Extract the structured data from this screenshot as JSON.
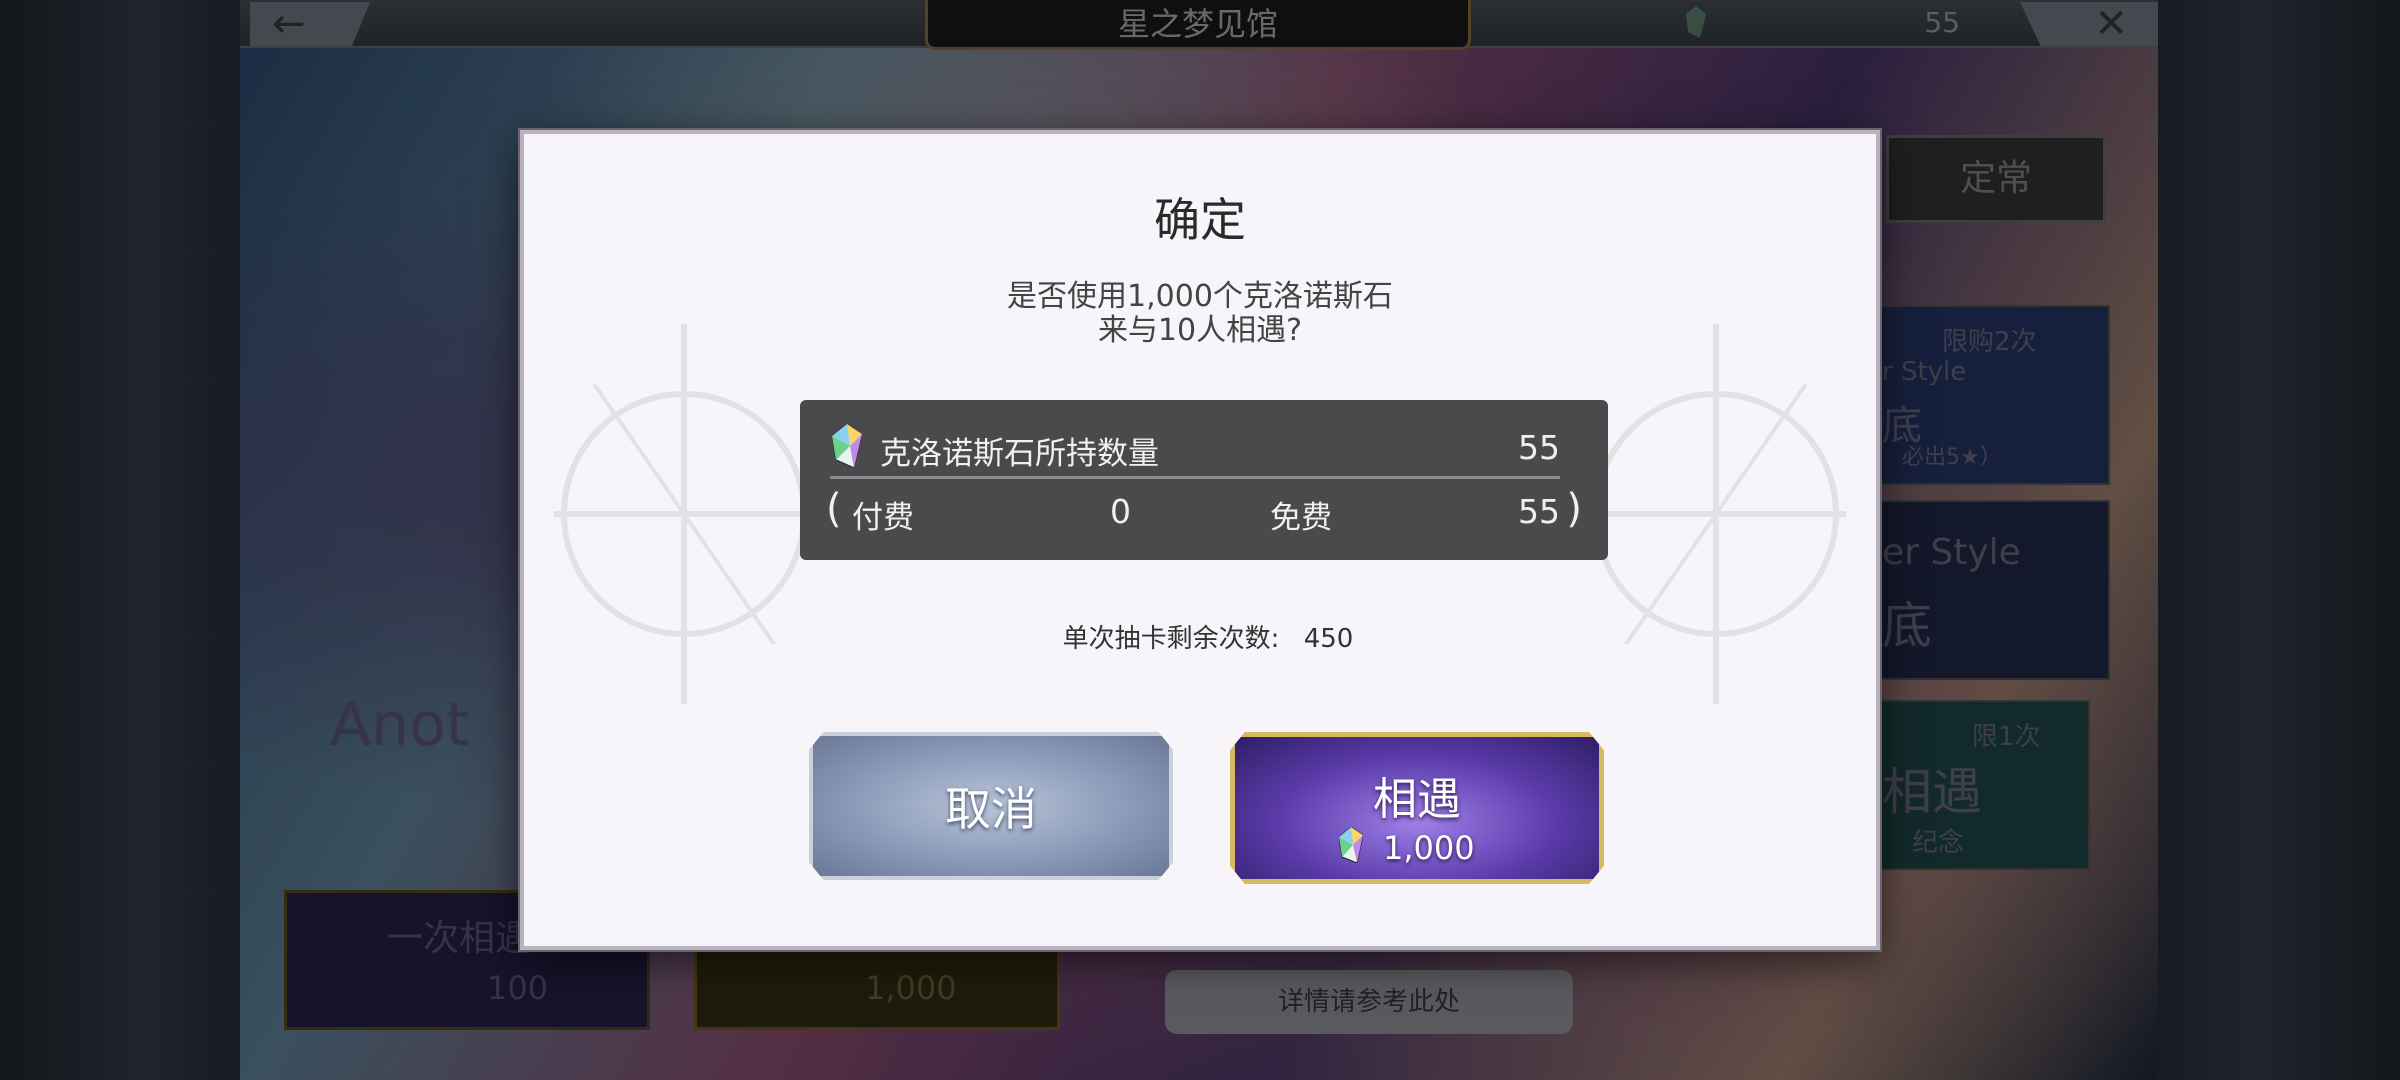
{
  "header": {
    "title": "星之梦见馆",
    "back_icon": "←",
    "close_icon": "✕",
    "currency_count": "55"
  },
  "background": {
    "tab_regular": "定常",
    "card1_badge": "限购2次",
    "card1_text": "r Style",
    "card1_sub": "底",
    "card1_note": "必出5★）",
    "card2_text": "er Style",
    "card2_sub": "底",
    "card3_badge": "限1次",
    "card3_text": "相遇",
    "card3_sub": "纪念",
    "banner_title": "Anot",
    "single_label": "一次相遇",
    "single_cost": "100",
    "ten_cost": "1,000",
    "details_button": "详情请参考此处"
  },
  "dialog": {
    "title": "确定",
    "message_line1": "是否使用1,000个克洛诺斯石",
    "message_line2": "来与10人相遇?",
    "stone_label": "克洛诺斯石所持数量",
    "stone_total": "55",
    "paren_open": "(",
    "paren_close": ")",
    "paid_label": "付费",
    "paid_value": "0",
    "free_label": "免费",
    "free_value": "55",
    "remaining_label": "单次抽卡剩余次数:",
    "remaining_value": "450",
    "cancel_button": "取消",
    "meet_button": "相遇",
    "meet_cost": "1,000"
  },
  "colors": {
    "dialog_bg": "#f7f5f9",
    "stone_box_bg": "#4a4a4c",
    "cancel_btn": "#8a9ab8",
    "meet_btn": "#5a3aa8",
    "meet_border": "#d8b860"
  },
  "icons": {
    "gem": "chronos-stone-icon",
    "back": "back-arrow-icon",
    "close": "close-icon"
  }
}
